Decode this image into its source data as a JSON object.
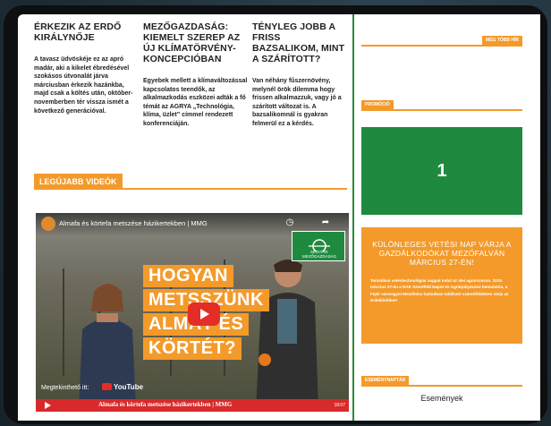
{
  "articles": [
    {
      "title": "ÉRKEZIK AZ ERDŐ KIRÁLYNŐJE",
      "excerpt": "A tavasz üdvöskéje ez az apró madár, aki a kikelet ébredésével szokásos útvonalát járva márciusban érkezik hazánkba, majd csak a költés után, október-novemberben tér vissza ismét a következő generációval."
    },
    {
      "title": "MEZŐGAZDASÁG: KIEMELT SZEREP AZ ÚJ KLÍMATÖRVÉNY-KONCEPCIÓBAN",
      "excerpt": "Egyebek mellett a klímaváltozással kapcsolatos teendők, az alkalmazkodás eszközei adták a fő témát az AGRYA „Technológia, klíma, üzlet” címmel rendezett konferenciáján."
    },
    {
      "title": "TÉNYLEG JOBB A FRISS BAZSALIKOM, MINT A SZÁRÍTOTT?",
      "excerpt": "Van néhány fűszernövény, melynél örök dilemma hogy frissen alkalmazzuk, vagy jó a szárított változat is. A bazsalikomnál is gyakran felmerül ez a kérdés."
    }
  ],
  "videos_section": {
    "label": "LEGÚJABB VIDEÓK"
  },
  "video": {
    "top_title": "Almafa és körtefa metszése házikertekben | MMG",
    "overlay_lines": [
      "HOGYAN",
      "METSSZÜNK",
      "ALMÁT ÉS",
      "KÖRTÉT?"
    ],
    "watch_on": "Megtekinthető itt:",
    "youtube": "YouTube",
    "badge_text": "MAGYAR MEZŐGAZDASÁG",
    "bar_title": "Almafa és körtefa metszése házikertekben | MMG",
    "bar_time": "18:07",
    "clock_label": "Megtekin...",
    "icons": {
      "clock": "clock-icon",
      "share": "share-icon",
      "play": "play-icon"
    }
  },
  "sidebar": {
    "more_label": "MÉG TÖBB HÍR",
    "promo_label": "PROMÓCIÓ",
    "promo_number": "1",
    "event": {
      "title": "KÜLÖNLEGES VETÉSI NAP VÁRJA A GAZDÁLKODÓKAT MEZŐFALVÁN MÁRCIUS 27-ÉN!",
      "body": "Tematikus vetéstechnológiai nappal indul az idei agrárszezon. 2026. március 27-én a NAK Szentföld Napot és Agrárpályázáse bemutatóa, a Fejér vármegyei Mezőfalva határában található szántóföldeken várja az érdeklődőket!"
    },
    "events_label": "ESEMÉNYNAPTÁR",
    "events_link": "Események"
  },
  "colors": {
    "accent": "#f39a2b",
    "green": "#1f8a3f",
    "red": "#d82a2a"
  }
}
